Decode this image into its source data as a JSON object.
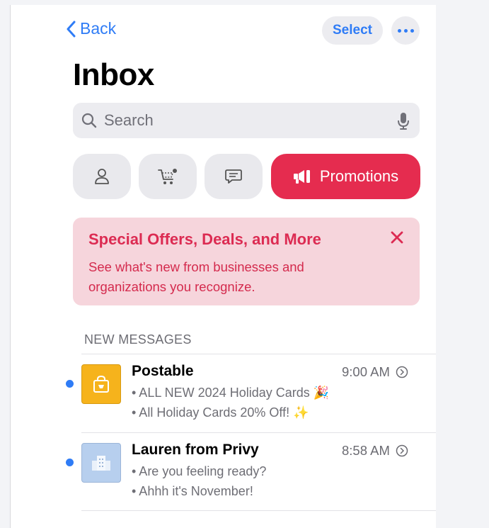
{
  "nav": {
    "back_label": "Back",
    "select_label": "Select",
    "more_icon": "ellipsis-icon"
  },
  "header": {
    "title": "Inbox"
  },
  "search": {
    "placeholder": "Search"
  },
  "categories": [
    {
      "id": "primary",
      "icon": "person-icon",
      "active": false
    },
    {
      "id": "transactions",
      "icon": "cart-icon",
      "active": false
    },
    {
      "id": "updates",
      "icon": "chat-bubble-icon",
      "active": false
    },
    {
      "id": "promotions",
      "icon": "megaphone-icon",
      "label": "Promotions",
      "active": true
    }
  ],
  "banner": {
    "title": "Special Offers, Deals, and More",
    "text": "See what's new from businesses and organizations you recognize."
  },
  "section": {
    "label": "NEW MESSAGES"
  },
  "messages": [
    {
      "sender": "Postable",
      "time": "9:00 AM",
      "line1": "• ALL NEW 2024 Holiday Cards 🎉",
      "line2": "• All Holiday Cards 20% Off! ✨",
      "unread": true
    },
    {
      "sender": "Lauren from Privy",
      "time": "8:58 AM",
      "line1": "• Are you feeling ready?",
      "line2": "• Ahhh it's November!",
      "unread": true
    }
  ],
  "colors": {
    "accent": "#2f7cf6",
    "promo": "#e52c4f",
    "banner_bg": "#f6d5dc",
    "banner_text": "#dc2b52"
  }
}
